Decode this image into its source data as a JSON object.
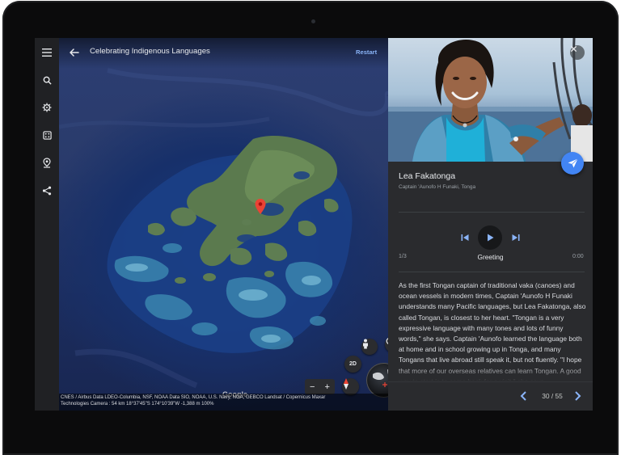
{
  "sidebar": {
    "items": [
      {
        "name": "menu-icon"
      },
      {
        "name": "search-icon"
      },
      {
        "name": "voyager-icon"
      },
      {
        "name": "dice-icon"
      },
      {
        "name": "projects-icon"
      },
      {
        "name": "share-icon"
      }
    ]
  },
  "map": {
    "story_title": "Celebrating Indigenous Languages",
    "restart_label": "Restart",
    "view_2d_label": "2D",
    "zoom_out": "−",
    "zoom_in": "+",
    "watermark": "Google",
    "attribution_line1": "CNES / Airbus Data LDEO-Columbia, NSF, NOAA Data SIO, NOAA, U.S. Navy, NGA, GEBCO Landsat / Copernicus Maxar",
    "attribution_line2": "Technologies   Camera :  54 km   18°37'45\"S 174°10'39\"W  -1,388 m   100%"
  },
  "panel": {
    "person_name": "Lea Fakatonga",
    "person_subtitle": "Captain 'Aunofo H Funaki, Tonga",
    "audio": {
      "track_index": "1/3",
      "track_name": "Greeting",
      "duration": "0:00"
    },
    "description": "As the first Tongan captain of traditional vaka (canoes) and ocean vessels in modern times, Captain 'Aunofo H Funaki understands many Pacific languages, but Lea Fakatonga, also called Tongan, is closest to her heart. \"Tongan is a very expressive language with many tones and lots of funny words,\" she says. Captain 'Aunofo learned the language both at home and in school growing up in Tonga, and many Tongans that live abroad still speak it, but not fluently. \"I hope that more of our overseas relatives can learn Tongan. A good way to start is to come back for a visit,\" she says.",
    "pager": "30 / 55"
  },
  "colors": {
    "accent": "#8ab4f8",
    "fab": "#4285f4",
    "pin": "#ea4335"
  }
}
